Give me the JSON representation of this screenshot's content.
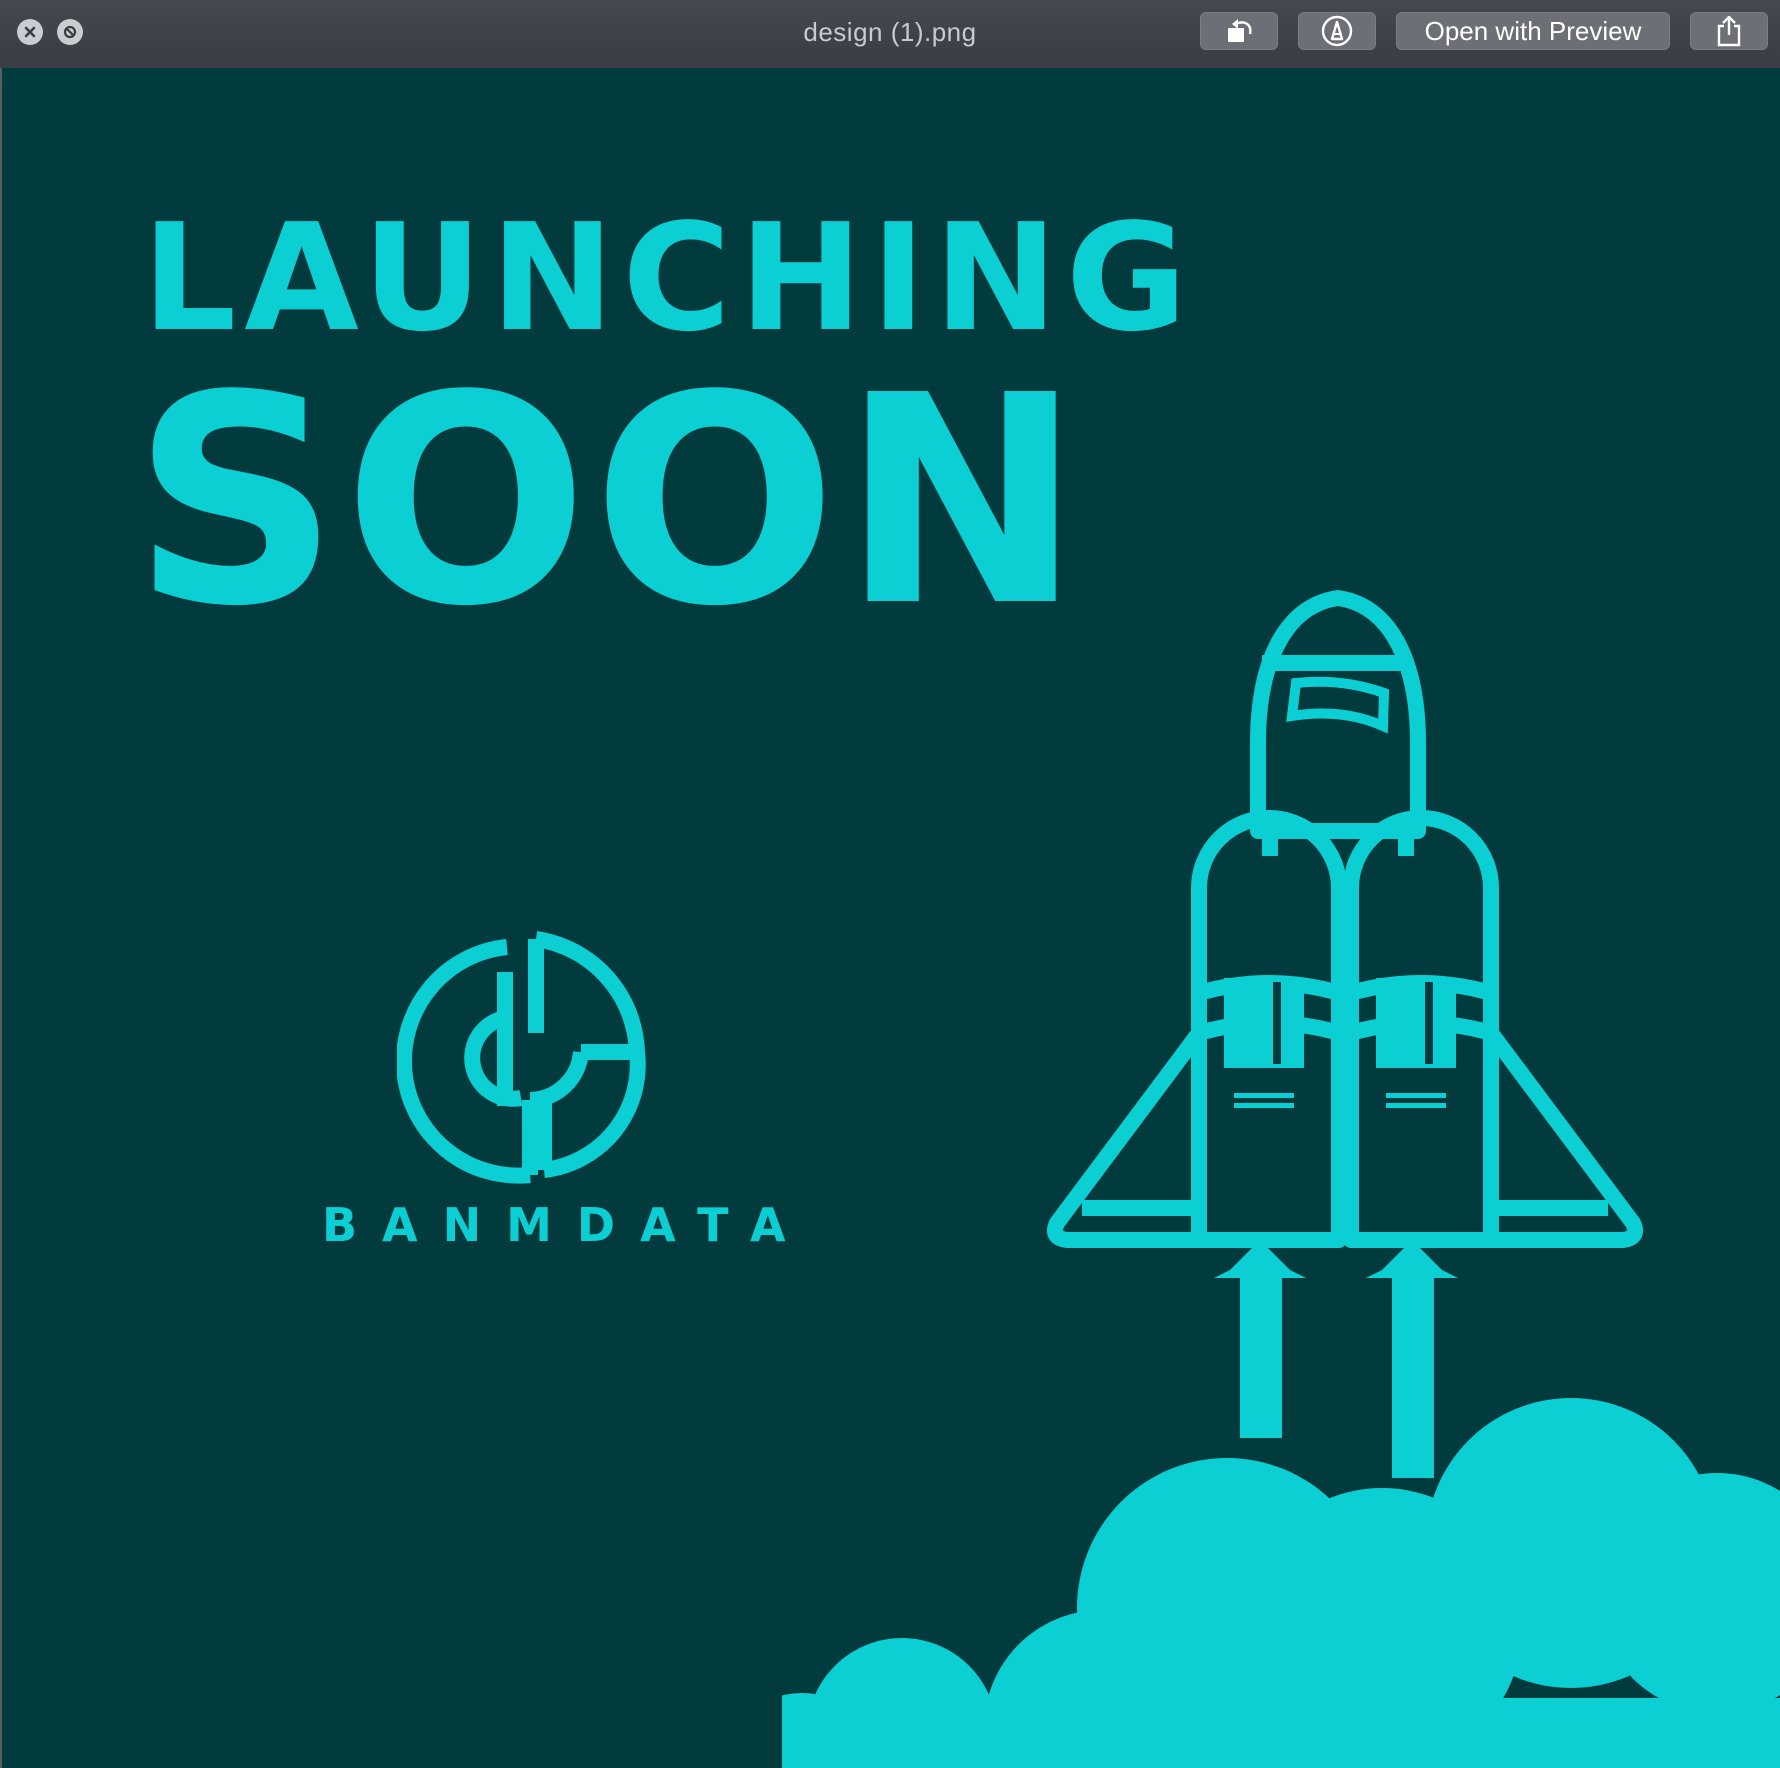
{
  "window": {
    "title": "design (1).png",
    "open_with_label": "Open with Preview",
    "icons": [
      "close-icon",
      "fullscreen-icon",
      "rotate-icon",
      "markup-icon",
      "share-icon"
    ]
  },
  "poster": {
    "headline_line1": "LAUNCHING",
    "headline_line2": "SOON",
    "brand_name": "BANMDATA",
    "colors": {
      "background": "#013b3e",
      "accent": "#0ccfd3"
    }
  }
}
